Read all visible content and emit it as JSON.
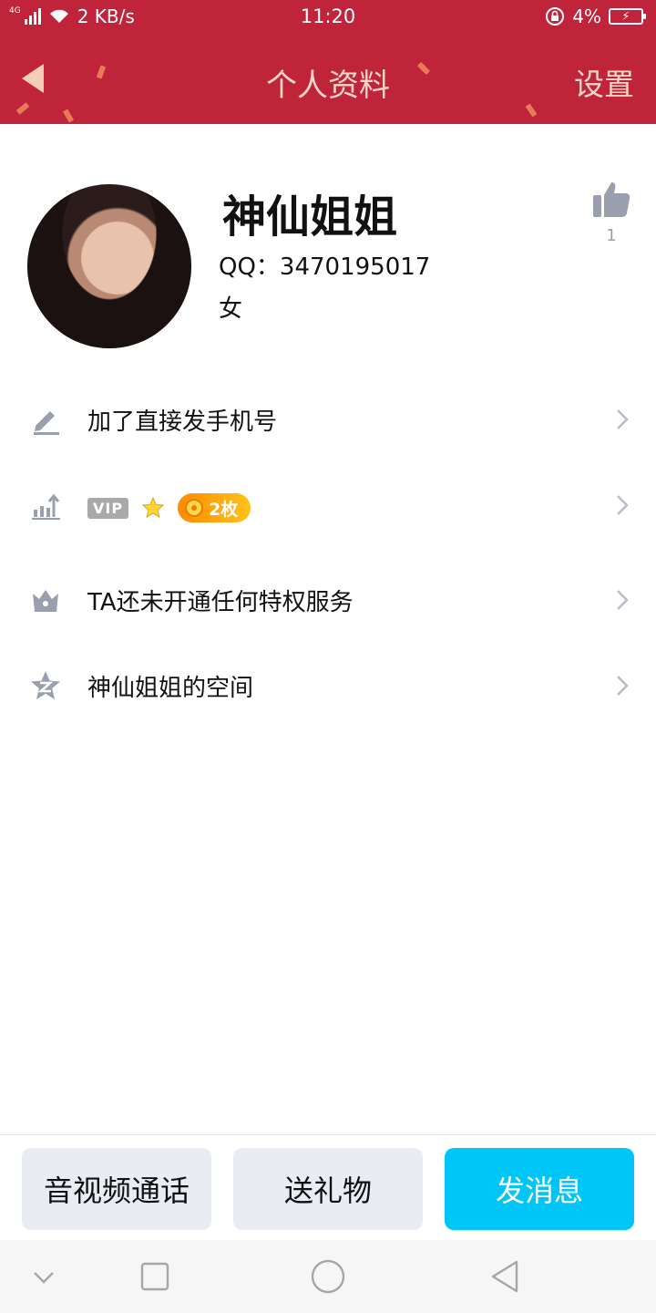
{
  "status_bar": {
    "network": "4G",
    "speed": "2 KB/s",
    "time": "11:20",
    "battery": "4%"
  },
  "nav": {
    "title": "个人资料",
    "settings": "设置"
  },
  "profile": {
    "name": "神仙姐姐",
    "qq": "QQ：3470195017",
    "gender": "女",
    "likes": "1"
  },
  "rows": {
    "signature": "加了直接发手机号",
    "vip_label": "VIP",
    "badge_count": "2枚",
    "privilege": "TA还未开通任何特权服务",
    "space": "神仙姐姐的空间"
  },
  "actions": {
    "call": "音视频通话",
    "gift": "送礼物",
    "message": "发消息"
  },
  "colors": {
    "header": "#c0243a",
    "primary_button": "#00c6f7",
    "secondary_button": "#e9ecf3",
    "icon_gray": "#9a9fb0"
  }
}
